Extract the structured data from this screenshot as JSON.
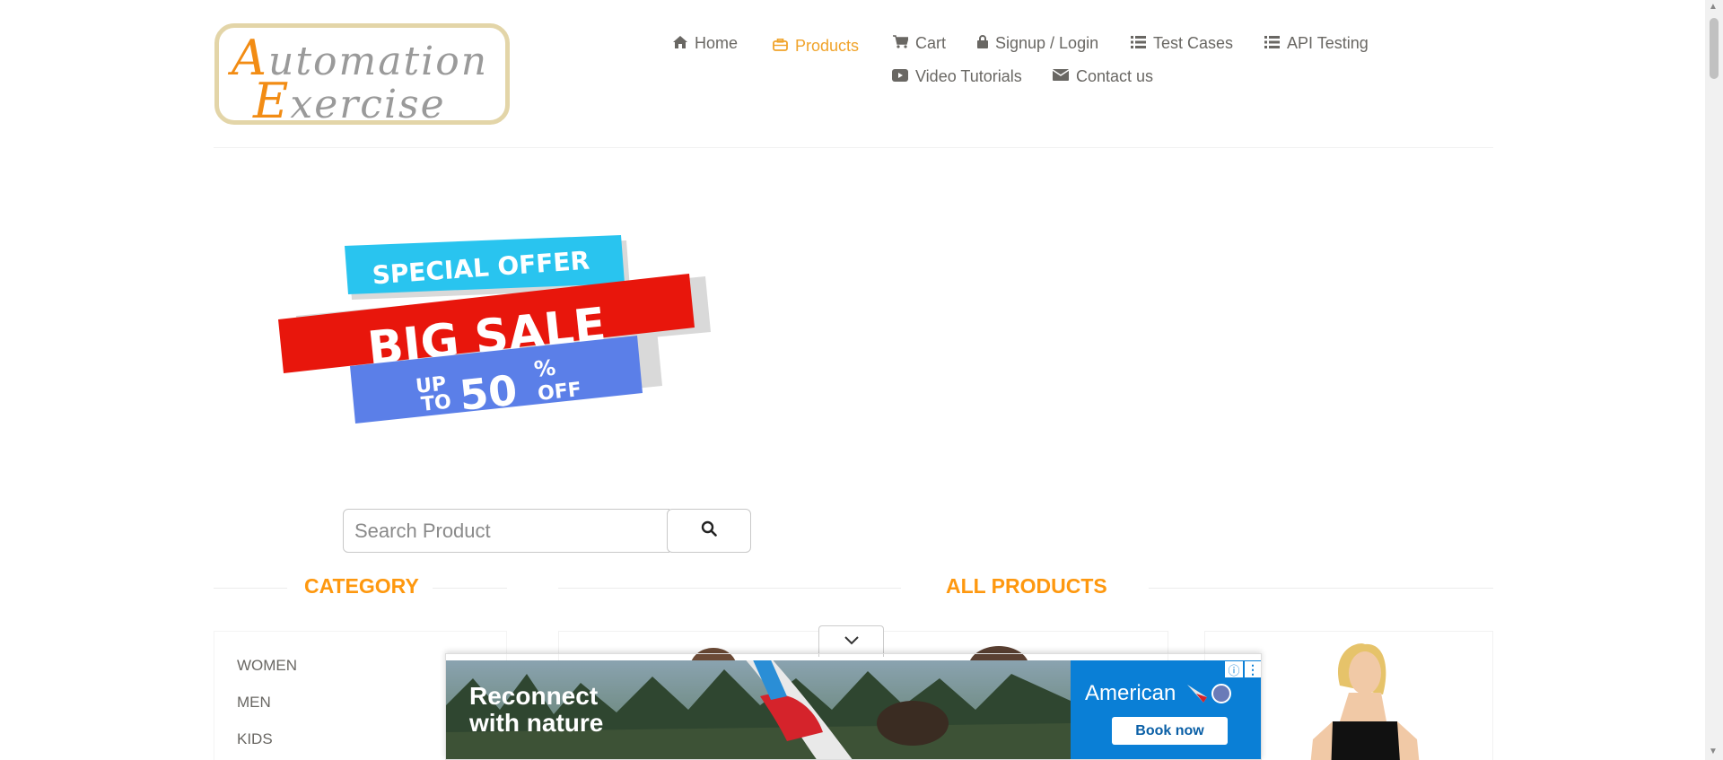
{
  "header": {
    "logo_text_line1": "Automation",
    "logo_text_line2": "Exercise",
    "nav": [
      {
        "label": "Home",
        "icon": "home-icon"
      },
      {
        "label": "Products",
        "icon": "briefcase-icon",
        "active": true
      },
      {
        "label": "Cart",
        "icon": "cart-icon"
      },
      {
        "label": "Signup / Login",
        "icon": "lock-icon"
      },
      {
        "label": "Test Cases",
        "icon": "list-icon"
      },
      {
        "label": "API Testing",
        "icon": "list-icon"
      },
      {
        "label": "Video Tutorials",
        "icon": "youtube-play-icon"
      },
      {
        "label": "Contact us",
        "icon": "envelope-icon"
      }
    ]
  },
  "banner": {
    "line1": "SPECIAL OFFER",
    "line2": "BIG SALE",
    "line3_up": "UP",
    "line3_to": "TO",
    "line3_value": "50",
    "line3_percent": "%",
    "line3_off": "OFF"
  },
  "search": {
    "placeholder": "Search Product",
    "button_icon": "search-icon"
  },
  "sections": {
    "category_title": "CATEGORY",
    "products_title": "ALL PRODUCTS"
  },
  "categories": [
    "WOMEN",
    "MEN",
    "KIDS"
  ],
  "ad": {
    "headline_line1": "Reconnect",
    "headline_line2": "with nature",
    "brand": "American",
    "cta": "Book now",
    "info_icon": "info-icon",
    "menu_icon": "kebab-menu-icon",
    "toggle_icon": "chevron-down-icon"
  },
  "colors": {
    "accent_orange": "#fe980f",
    "nav_active": "#f0a32a",
    "text_gray": "#696763",
    "ad_blue": "#0a7fd6"
  }
}
